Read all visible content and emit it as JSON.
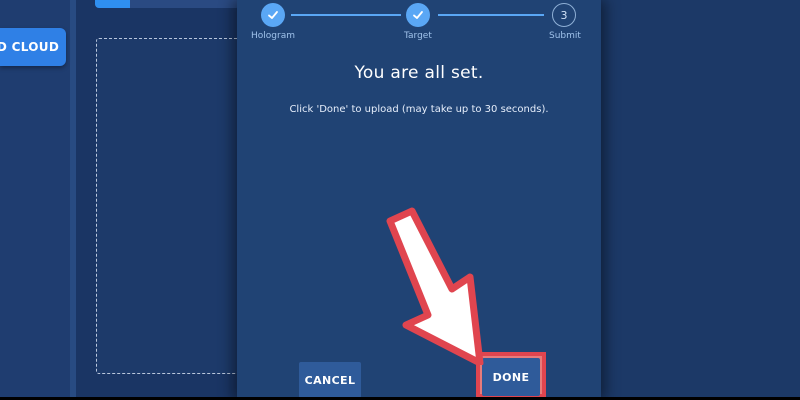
{
  "sidebar": {
    "cloud_button_label": "D CLOUD"
  },
  "stepper": {
    "steps": [
      {
        "label": "Hologram",
        "state": "completed"
      },
      {
        "label": "Target",
        "state": "completed"
      },
      {
        "label": "Submit",
        "number": "3",
        "state": "current"
      }
    ]
  },
  "dialog": {
    "title": "You are all set.",
    "message": "Click 'Done' to upload (may take up to 30 seconds).",
    "cancel_label": "CANCEL",
    "done_label": "DONE"
  },
  "annotation": {
    "arrow_color": "#e0454f",
    "highlight_color": "#e0454f"
  },
  "colors": {
    "background": "#1a3564",
    "accent": "#5aa7f5",
    "button": "#2f5b9a"
  }
}
